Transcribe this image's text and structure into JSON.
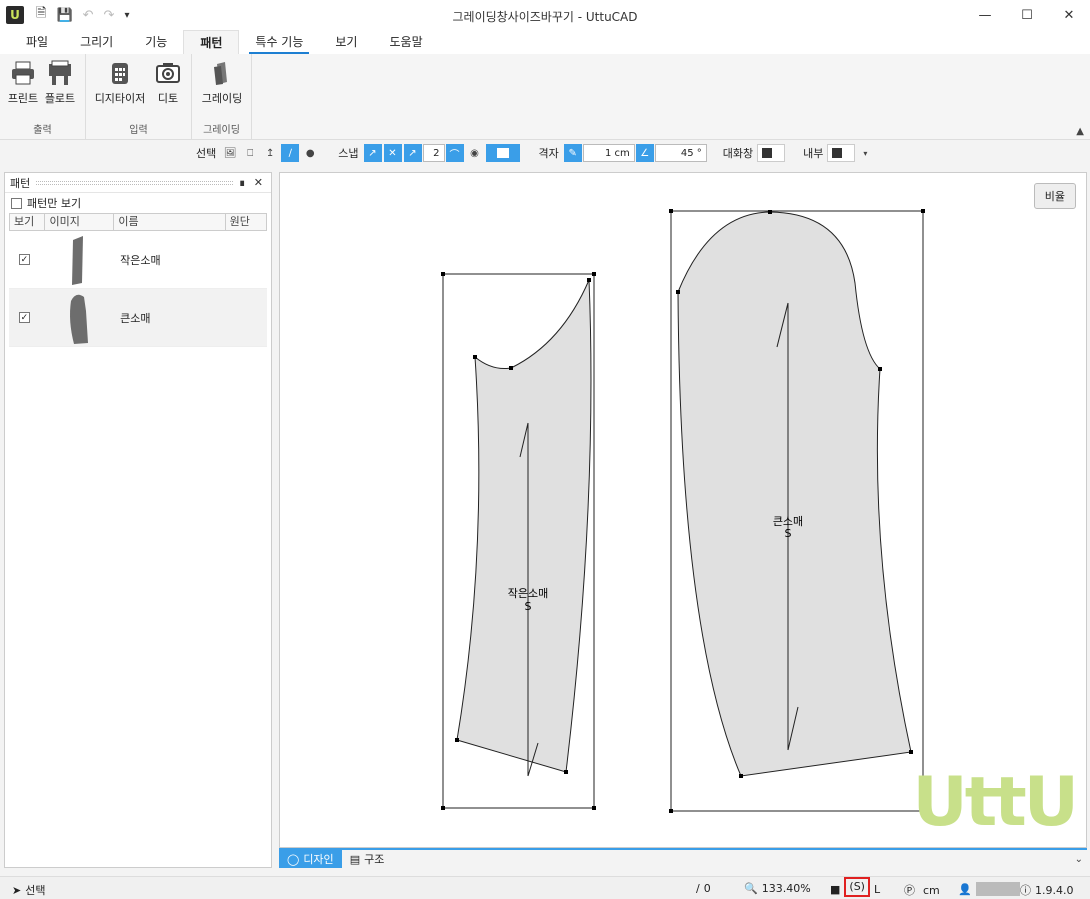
{
  "app": {
    "logo": "U",
    "title": "그레이딩창사이즈바꾸기 - UttuCAD"
  },
  "quick_access": [
    "new-file-icon",
    "save-icon",
    "undo-icon",
    "redo-icon",
    "customize-icon"
  ],
  "ribbon": {
    "tabs": [
      "파일",
      "그리기",
      "기능",
      "패턴",
      "특수 기능",
      "보기",
      "도움말"
    ],
    "active_tab": "패턴",
    "groups": {
      "output": {
        "label": "출력",
        "buttons": [
          "프린트",
          "플로트"
        ]
      },
      "input": {
        "label": "입력",
        "buttons": [
          "디지타이저",
          "디토"
        ]
      },
      "grading": {
        "label": "그레이딩",
        "buttons": [
          "그레이딩"
        ]
      }
    }
  },
  "toolstrip": {
    "select_label": "선택",
    "snap_label": "스냅",
    "snap_value": "2",
    "grid_label": "격자",
    "grid_value": "1 cm",
    "angle_value": "45 °",
    "dialog_label": "대화창",
    "inner_label": "내부"
  },
  "pattern_panel": {
    "title": "패턴",
    "only_pattern_label": "패턴만 보기",
    "columns": [
      "보기",
      "이미지",
      "이름",
      "원단"
    ],
    "rows": [
      {
        "visible": "✓",
        "name": "작은소매",
        "fabric": ""
      },
      {
        "visible": "✓",
        "name": "큰소매",
        "fabric": ""
      }
    ]
  },
  "canvas": {
    "ratio_button": "비율",
    "pieces": [
      {
        "name": "작은소매",
        "size_mark": "S"
      },
      {
        "name": "큰소매",
        "size_mark": "S"
      }
    ],
    "watermark": "UttU",
    "fill_color": "#e0e0e0"
  },
  "bottom_tabs": [
    "디자인",
    "구조"
  ],
  "status": {
    "mode": "선택",
    "line_count": "0",
    "zoom": "133.40%",
    "size_range_s": "(S)",
    "size_range_l": "L",
    "unit": "cm",
    "version": "1.9.4.0"
  }
}
